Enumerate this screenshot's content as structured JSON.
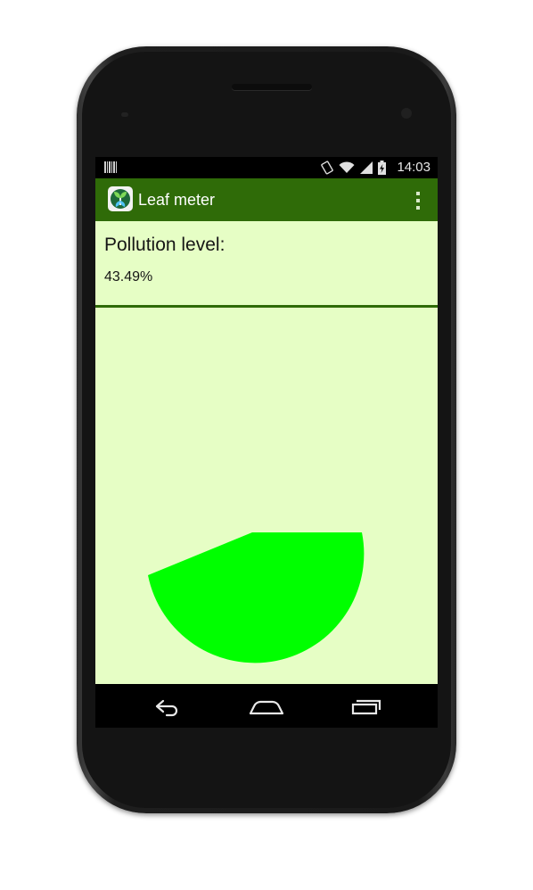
{
  "status_bar": {
    "time": "14:03",
    "left_icon": "notification-barcode-icon",
    "icons": [
      "rotation-lock-icon",
      "wifi-icon",
      "signal-icon",
      "battery-charging-icon"
    ]
  },
  "action_bar": {
    "title": "Leaf meter",
    "app_icon": "leaf-app-icon",
    "menu_icon": "overflow-menu-icon",
    "background_color": "#2f6b08"
  },
  "content": {
    "pollution_label": "Pollution level:",
    "pollution_value": "43.49%",
    "pollution_fraction": 0.4349,
    "background_color": "#e6fec5",
    "leaf_color": "#00ff00"
  },
  "nav_bar": {
    "buttons": [
      "back-icon",
      "home-icon",
      "recents-icon"
    ]
  }
}
